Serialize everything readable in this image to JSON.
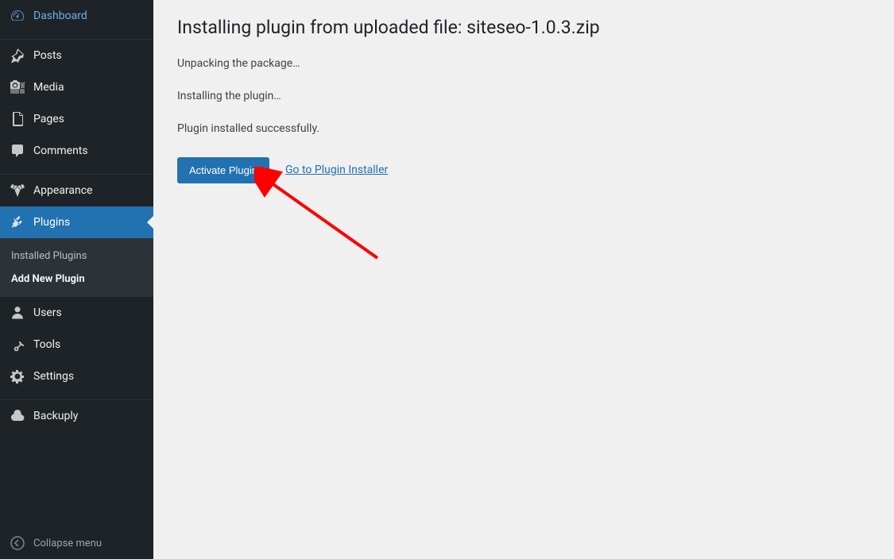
{
  "sidebar": {
    "items": [
      {
        "label": "Dashboard",
        "icon": "dashboard"
      },
      {
        "label": "Posts",
        "icon": "pin"
      },
      {
        "label": "Media",
        "icon": "media"
      },
      {
        "label": "Pages",
        "icon": "pages"
      },
      {
        "label": "Comments",
        "icon": "comments"
      },
      {
        "label": "Appearance",
        "icon": "appearance"
      },
      {
        "label": "Plugins",
        "icon": "plugins"
      },
      {
        "label": "Users",
        "icon": "users"
      },
      {
        "label": "Tools",
        "icon": "tools"
      },
      {
        "label": "Settings",
        "icon": "settings"
      },
      {
        "label": "Backuply",
        "icon": "backup"
      }
    ],
    "submenu": {
      "items": [
        {
          "label": "Installed Plugins"
        },
        {
          "label": "Add New Plugin"
        }
      ]
    },
    "collapse_label": "Collapse menu"
  },
  "main": {
    "title": "Installing plugin from uploaded file: siteseo-1.0.3.zip",
    "status1": "Unpacking the package…",
    "status2": "Installing the plugin…",
    "status3": "Plugin installed successfully.",
    "activate_label": "Activate Plugin",
    "installer_link": "Go to Plugin Installer"
  }
}
